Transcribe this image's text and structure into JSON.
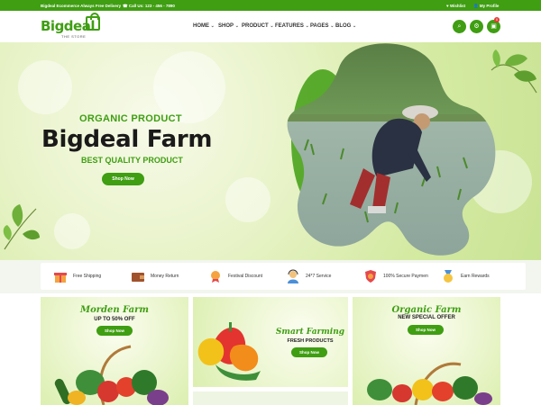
{
  "topbar": {
    "promo": "Bigdeal Ecommerce Always Free Delivery",
    "phone": "Call Us: 123 - 456 - 7890",
    "wishlist": "Wishlist",
    "profile": "My Profile"
  },
  "logo": {
    "name": "Bigdeal",
    "tagline": "THE STORE"
  },
  "nav": [
    "HOME",
    "SHOP",
    "PRODUCT",
    "FEATURES",
    "PAGES",
    "BLOG"
  ],
  "cart_count": "0",
  "hero": {
    "eyebrow": "ORGANIC PRODUCT",
    "title": "Bigdeal Farm",
    "subtitle": "BEST QUALITY PRODUCT",
    "cta": "Shop Now"
  },
  "features": [
    "Free Shipping",
    "Money Return",
    "Festival Discount",
    "24*7 Service",
    "100% Secure Payment",
    "Earn Rewards"
  ],
  "banners": [
    {
      "title": "Morden Farm",
      "subtitle": "UP TO 50% OFF",
      "cta": "Shop Now"
    },
    {
      "title": "Smart Farming",
      "subtitle": "FRESH PRODUCTS",
      "cta": "Shop Now"
    },
    {
      "title": "Organic Farm",
      "subtitle": "NEW SPECIAL OFFER",
      "cta": "Shop Now"
    }
  ],
  "colors": {
    "brand": "#3f9e12",
    "hero_bg": "#d4eaa2",
    "badge": "#e53935"
  }
}
